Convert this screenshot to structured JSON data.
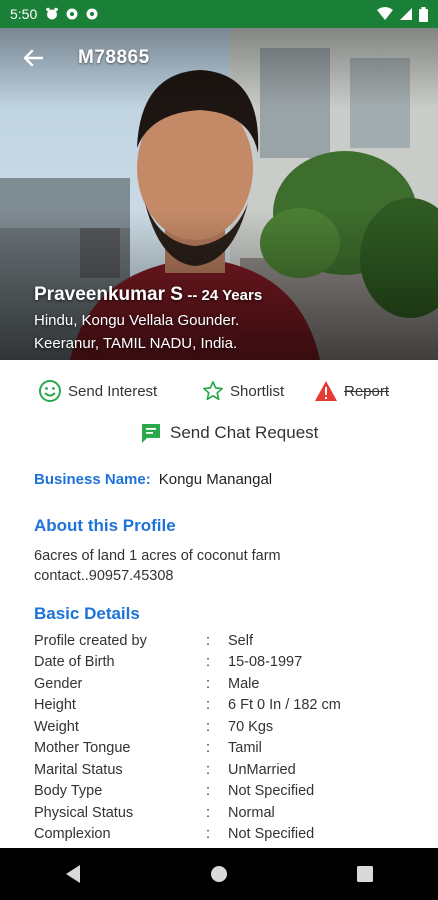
{
  "status_bar": {
    "time": "5:50"
  },
  "header": {
    "profile_id": "M78865"
  },
  "profile": {
    "name": "Praveenkumar S",
    "age": "-- 24 Years",
    "community": "Hindu, Kongu Vellala Gounder.",
    "location": "Keeranur, TAMIL NADU, India."
  },
  "actions": {
    "send_interest": "Send Interest",
    "shortlist": "Shortlist",
    "report": "Report",
    "send_chat_request": "Send Chat Request"
  },
  "business": {
    "label": "Business Name:",
    "value": "Kongu Manangal"
  },
  "about": {
    "title": "About this Profile",
    "line1": "6acres of land 1 acres of coconut farm",
    "line2": "contact..90957.45308"
  },
  "basic_details": {
    "title": "Basic Details",
    "rows": [
      {
        "key": "Profile created by",
        "value": "Self"
      },
      {
        "key": "Date of Birth",
        "value": "15-08-1997"
      },
      {
        "key": "Gender",
        "value": "Male"
      },
      {
        "key": "Height",
        "value": "6 Ft 0 In / 182 cm"
      },
      {
        "key": "Weight",
        "value": "70 Kgs"
      },
      {
        "key": "Mother Tongue",
        "value": "Tamil"
      },
      {
        "key": "Marital Status",
        "value": "UnMarried"
      },
      {
        "key": "Body Type",
        "value": "Not Specified"
      },
      {
        "key": "Physical Status",
        "value": "Normal"
      },
      {
        "key": "Complexion",
        "value": "Not Specified"
      }
    ]
  },
  "colors": {
    "status_bar": "#1a7f37",
    "accent_blue": "#1e73d8",
    "interest_green": "#2aa84a",
    "report_red": "#e53935"
  },
  "icons": {
    "interest": "smiley-icon",
    "shortlist": "star-outline-icon",
    "report": "warning-icon",
    "chat": "chat-bubble-icon"
  }
}
